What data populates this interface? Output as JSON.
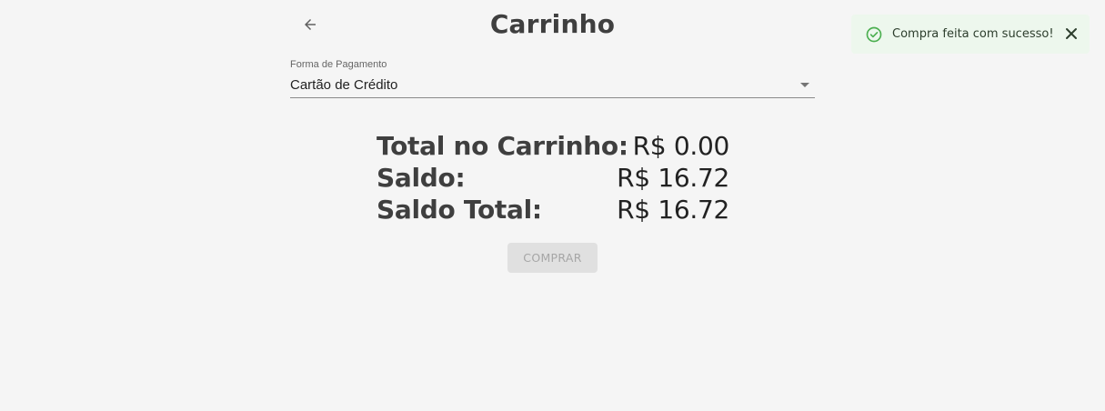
{
  "header": {
    "title": "Carrinho",
    "back_icon": "arrow-left-icon"
  },
  "payment": {
    "label": "Forma de Pagamento",
    "selected": "Cartão de Crédito",
    "dropdown_icon": "caret-down-icon"
  },
  "summary": {
    "cart_total_label": "Total no Carrinho:",
    "cart_total_value": "R$ 0.00",
    "balance_label": "Saldo:",
    "balance_value": "R$ 16.72",
    "total_balance_label": "Saldo Total:",
    "total_balance_value": "R$ 16.72"
  },
  "actions": {
    "buy_label": "COMPRAR",
    "buy_disabled": true
  },
  "toast": {
    "message": "Compra feita com sucesso!",
    "icon": "check-circle-icon",
    "close_icon": "close-icon",
    "color": "#4caf50",
    "background": "#edf7ed"
  }
}
